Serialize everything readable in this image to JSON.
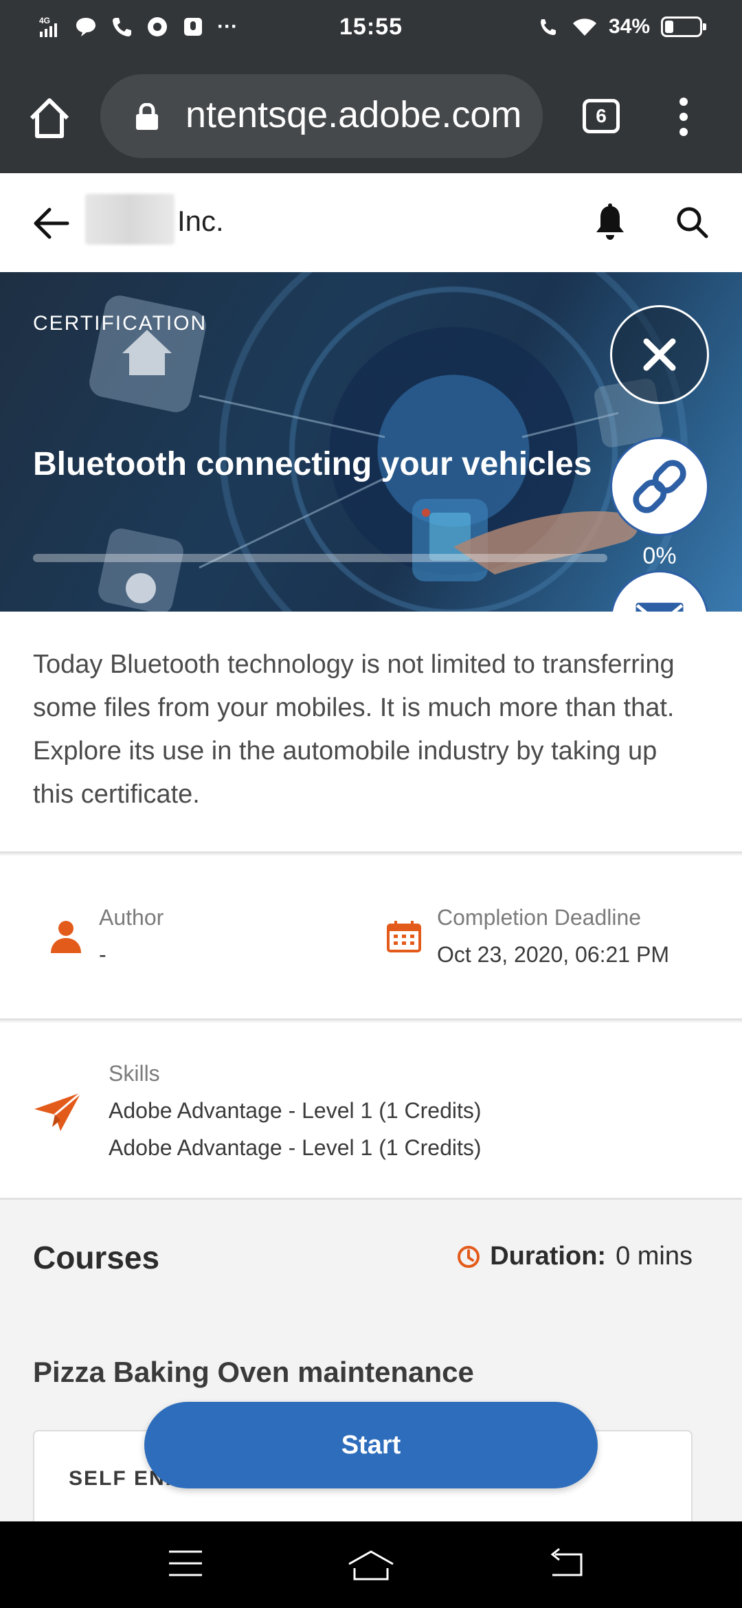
{
  "status_bar": {
    "network": "4G",
    "time": "15:55",
    "battery_percent": "34%",
    "battery_level": 0.34
  },
  "browser": {
    "url": "ntentsqe.adobe.com",
    "tab_count": "6"
  },
  "header": {
    "company": "Inc."
  },
  "hero": {
    "tag": "CERTIFICATION",
    "title": "Bluetooth connecting your vehicles",
    "progress_label": "0%",
    "progress_value": 0
  },
  "description": "Today Bluetooth technology is not limited to transferring some files from your mobiles. It is much more than that. Explore its use in the automobile industry by taking up this certificate.",
  "meta": {
    "author_label": "Author",
    "author_value": "-",
    "deadline_label": "Completion Deadline",
    "deadline_value": "Oct 23, 2020, 06:21 PM"
  },
  "skills": {
    "label": "Skills",
    "items": [
      "Adobe Advantage - Level 1 (1 Credits)",
      "Adobe Advantage - Level 1 (1 Credits)"
    ]
  },
  "courses": {
    "title": "Courses",
    "duration_label": "Duration:",
    "duration_value": "0 mins",
    "course_name": "Pizza Baking Oven maintenance",
    "card_tag": "SELF ENR"
  },
  "actions": {
    "start_label": "Start"
  },
  "colors": {
    "accent_orange": "#e35b1b",
    "primary_blue": "#2d6dbc",
    "browser_chrome": "#333639"
  },
  "icons": [
    "home-icon",
    "lock-icon",
    "back-arrow-icon",
    "bell-icon",
    "search-icon",
    "close-icon",
    "link-icon",
    "mail-icon",
    "person-icon",
    "calendar-icon",
    "paper-plane-icon",
    "clock-icon"
  ]
}
